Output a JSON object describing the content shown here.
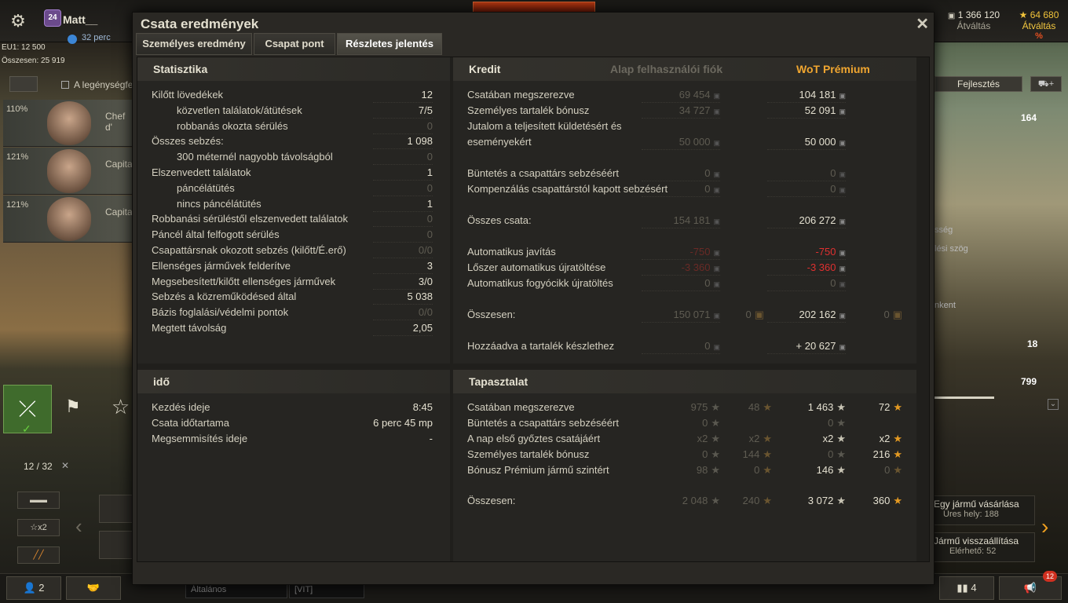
{
  "topbar": {
    "level": "24",
    "player": "Matt__",
    "premium_time": "32 perc",
    "credits": {
      "amount": "1 366 120",
      "label": "Átváltás"
    },
    "gold": {
      "amount": "64 680",
      "label": "Átváltás",
      "badge": "%"
    }
  },
  "left": {
    "eu1": "EU1: 12 500",
    "total": "Összesen: 25 919",
    "crew_filter": "A legénységfe",
    "crew": [
      {
        "pct": "110%",
        "rank": "Chef d'"
      },
      {
        "pct": "121%",
        "rank": "Capita"
      },
      {
        "pct": "121%",
        "rank": "Capita"
      }
    ],
    "vehicle_count": "12 / 32",
    "x2": "x2"
  },
  "right": {
    "develop_button": "Fejlesztés",
    "n164": "164",
    "n18": "18",
    "n799": "799",
    "txt1": "sség",
    "txt2": "lési szög",
    "txt3": "nkent",
    "buy_card": {
      "title": "Egy jármű vásárlása",
      "sub": "Üres hely: 188"
    },
    "restore_card": {
      "title": "Jármű visszaállítása",
      "sub": "Elérhető: 52"
    }
  },
  "bottom": {
    "platoon": "2",
    "chat_tab1": "Általános",
    "chat_tab2": "[VIT]",
    "right_count": "4",
    "notif": "12"
  },
  "modal": {
    "title": "Csata eredmények",
    "tabs": [
      "Személyes eredmény",
      "Csapat pont",
      "Részletes jelentés"
    ],
    "stats": {
      "header": "Statisztika",
      "rows": [
        {
          "label": "Kilőtt lövedékek",
          "value": "12",
          "indent": false,
          "dim": false
        },
        {
          "label": "közvetlen találatok/átütések",
          "value": "7/5",
          "indent": true,
          "dim": false
        },
        {
          "label": "robbanás okozta sérülés",
          "value": "0",
          "indent": true,
          "dim": true
        },
        {
          "label": "Összes sebzés:",
          "value": "1 098",
          "indent": false,
          "dim": false
        },
        {
          "label": "300 méternél nagyobb távolságból",
          "value": "0",
          "indent": true,
          "dim": true
        },
        {
          "label": "Elszenvedett találatok",
          "value": "1",
          "indent": false,
          "dim": false
        },
        {
          "label": "páncélátütés",
          "value": "0",
          "indent": true,
          "dim": true
        },
        {
          "label": "nincs páncélátütés",
          "value": "1",
          "indent": true,
          "dim": false
        },
        {
          "label": "Robbanási sérüléstől elszenvedett találatok",
          "value": "0",
          "indent": false,
          "dim": true
        },
        {
          "label": "Páncél által felfogott sérülés",
          "value": "0",
          "indent": false,
          "dim": true
        },
        {
          "label": "Csapattársnak okozott sebzés (kilőtt/É.erő)",
          "value": "0/0",
          "indent": false,
          "dim": true
        },
        {
          "label": "Ellenséges járművek felderítve",
          "value": "3",
          "indent": false,
          "dim": false
        },
        {
          "label": "Megsebesített/kilőtt ellenséges járművek",
          "value": "3/0",
          "indent": false,
          "dim": false
        },
        {
          "label": "Sebzés a közreműködésed által",
          "value": "5 038",
          "indent": false,
          "dim": false
        },
        {
          "label": "Bázis foglalási/védelmi pontok",
          "value": "0/0",
          "indent": false,
          "dim": true
        },
        {
          "label": "Megtett távolság",
          "value": "2,05",
          "indent": false,
          "dim": false
        }
      ]
    },
    "time": {
      "header": "idő",
      "rows": [
        {
          "label": "Kezdés ideje",
          "value": "8:45"
        },
        {
          "label": "Csata időtartama",
          "value": "6 perc 45 mp"
        },
        {
          "label": "Megsemmisítés ideje",
          "value": "-"
        }
      ]
    },
    "credit": {
      "header": "Kredit",
      "col_basic": "Alap felhasználói fiók",
      "col_prem": "WoT Prémium",
      "rows": [
        {
          "label": "Csatában megszerezve",
          "b": "69 454",
          "p": "104 181"
        },
        {
          "label": "Személyes tartalék bónusz",
          "b": "34 727",
          "p": "52 091"
        },
        {
          "label": "Jutalom a teljesített küldetésért és",
          "label2": "eseményekért",
          "b": "50 000",
          "p": "50 000"
        },
        {
          "label": "Büntetés a csapattárs sebzéséért",
          "b": "0",
          "p": "0",
          "pdim": true
        },
        {
          "label": "Kompenzálás csapattárstól kapott sebzésért",
          "b": "0",
          "p": "0",
          "pdim": true
        },
        {
          "label": "Összes csata:",
          "b": "154 181",
          "p": "206 272"
        },
        {
          "label": "Automatikus javítás",
          "b": "-750",
          "p": "-750",
          "red": true
        },
        {
          "label": "Lőszer automatikus újratöltése",
          "b": "-3 360",
          "p": "-3 360",
          "red": true
        },
        {
          "label": "Automatikus fogyócikk újratöltés",
          "b": "0",
          "p": "0",
          "pdim": true
        },
        {
          "label": "Összesen:",
          "b": "150 071",
          "bg": "0",
          "p": "202 162",
          "pg": "0"
        },
        {
          "label": "Hozzáadva a tartalék készlethez",
          "b": "0",
          "p": "+ 20 627"
        }
      ]
    },
    "xp": {
      "header": "Tapasztalat",
      "rows": [
        {
          "label": "Csatában megszerezve",
          "b": "975",
          "bf": "48",
          "p": "1 463",
          "pf": "72"
        },
        {
          "label": "Büntetés a csapattárs sebzéséért",
          "b": "0",
          "p": "0"
        },
        {
          "label": "A nap első győztes csatájáért",
          "b": "x2",
          "bf": "x2",
          "p": "x2",
          "pf": "x2"
        },
        {
          "label": "Személyes tartalék bónusz",
          "b": "0",
          "bf": "144",
          "p": "0",
          "pf": "216"
        },
        {
          "label": "Bónusz Prémium jármű szintért",
          "b": "98",
          "bf": "0",
          "p": "146",
          "pf": "0"
        },
        {
          "label": "Összesen:",
          "b": "2 048",
          "bf": "240",
          "p": "3 072",
          "pf": "360"
        }
      ]
    }
  }
}
